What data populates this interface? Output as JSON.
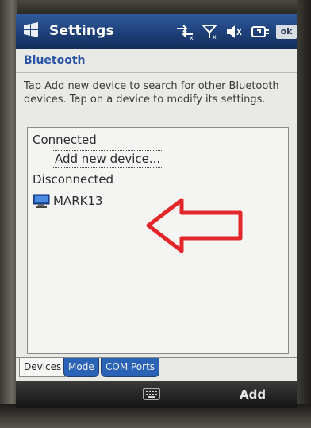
{
  "titlebar": {
    "title": "Settings",
    "ok_label": "ok"
  },
  "subheader": {
    "title": "Bluetooth"
  },
  "instructions": "Tap Add new device to search for other Bluetooth devices. Tap on a device to modify its settings.",
  "device_list": {
    "connected_label": "Connected",
    "add_new_device": "Add new device...",
    "disconnected_label": "Disconnected",
    "devices": [
      {
        "name": "MARK13",
        "icon": "computer-icon"
      }
    ]
  },
  "tabs": [
    {
      "label": "Devices",
      "active": true
    },
    {
      "label": "Mode",
      "active": false
    },
    {
      "label": "COM Ports",
      "active": false
    }
  ],
  "softkeys": {
    "left_icon": "keyboard-icon",
    "right_label": "Add"
  },
  "colors": {
    "titlebar": "#1d3f78",
    "accent_text": "#2a55a7",
    "tab_inactive": "#2a63b5",
    "annotation_arrow": "#e3262a"
  }
}
